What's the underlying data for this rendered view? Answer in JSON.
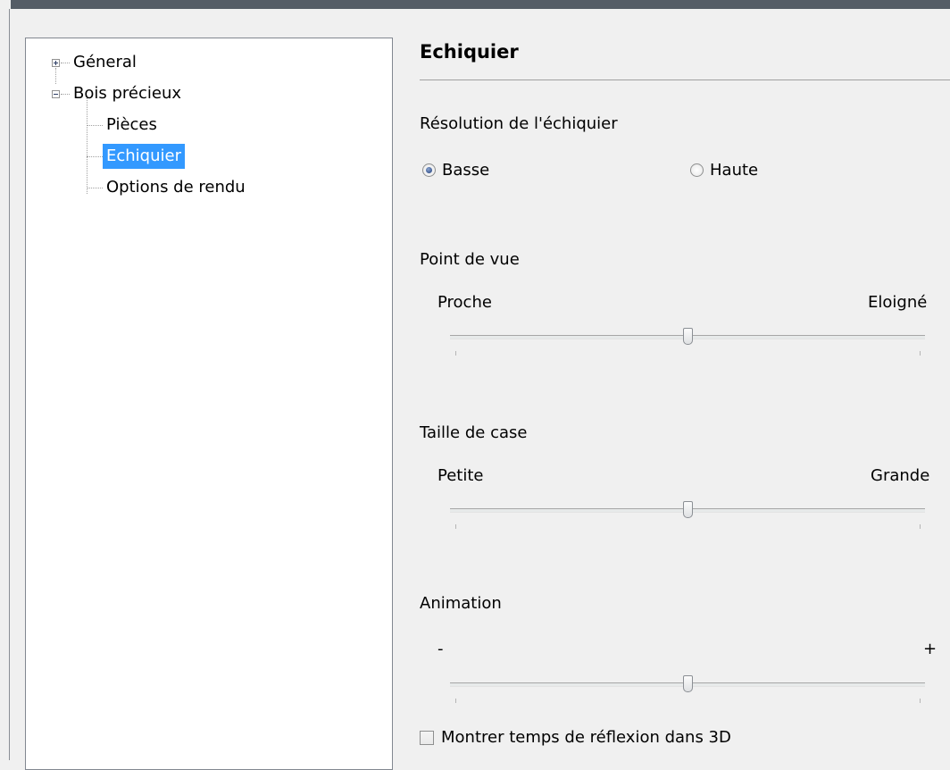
{
  "tree": {
    "items": [
      {
        "label": "Géneral",
        "expander": "plus"
      },
      {
        "label": "Bois précieux",
        "expander": "minus"
      },
      {
        "label": "Pièces"
      },
      {
        "label": "Echiquier",
        "selected": true
      },
      {
        "label": "Options de rendu"
      }
    ]
  },
  "panel": {
    "title": "Echiquier",
    "resolution": {
      "label": "Résolution de l'échiquier",
      "options": [
        {
          "label": "Basse",
          "checked": true
        },
        {
          "label": "Haute",
          "checked": false
        }
      ]
    },
    "viewpoint": {
      "label": "Point de vue",
      "min_label": "Proche",
      "max_label": "Eloigné",
      "value": 0.5
    },
    "square_size": {
      "label": "Taille de case",
      "min_label": "Petite",
      "max_label": "Grande",
      "value": 0.5
    },
    "animation": {
      "label": "Animation",
      "min_label": "-",
      "max_label": "+",
      "value": 0.5
    },
    "think_time": {
      "label": "Montrer temps de réflexion dans 3D",
      "checked": false
    }
  },
  "colors": {
    "selection": "#3399ff",
    "window_border": "#555d66"
  }
}
